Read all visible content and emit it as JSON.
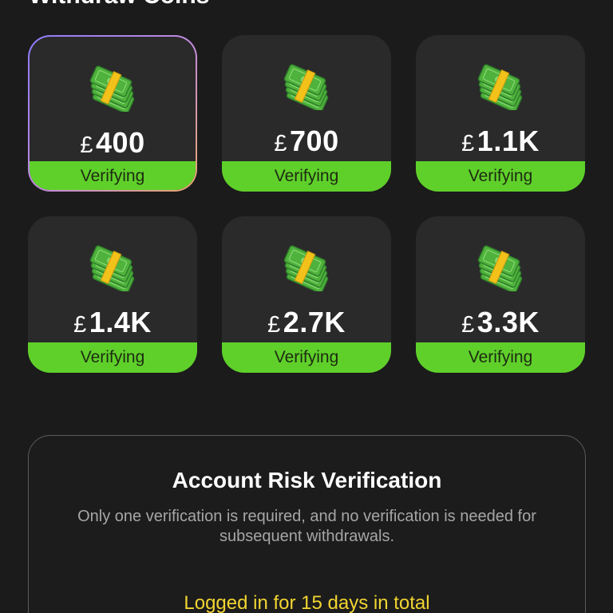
{
  "section": {
    "title": "Withdraw Coins"
  },
  "currency_symbol": "£",
  "cards": [
    {
      "amount": "400",
      "status": "Verifying",
      "selected": true
    },
    {
      "amount": "700",
      "status": "Verifying",
      "selected": false
    },
    {
      "amount": "1.1K",
      "status": "Verifying",
      "selected": false
    },
    {
      "amount": "1.4K",
      "status": "Verifying",
      "selected": false
    },
    {
      "amount": "2.7K",
      "status": "Verifying",
      "selected": false
    },
    {
      "amount": "3.3K",
      "status": "Verifying",
      "selected": false
    }
  ],
  "risk": {
    "title": "Account Risk Verification",
    "description": "Only one verification is required, and no verification is needed for subsequent withdrawals.",
    "login_status": "Logged in for 15 days in total"
  },
  "icons": {
    "card_icon": "money-stack-icon"
  },
  "colors": {
    "background": "#1b1b1b",
    "card": "#2a2a2a",
    "status_green": "#5fd02a",
    "highlight_yellow": "#f2d531",
    "muted_text": "#a6a6a6"
  }
}
